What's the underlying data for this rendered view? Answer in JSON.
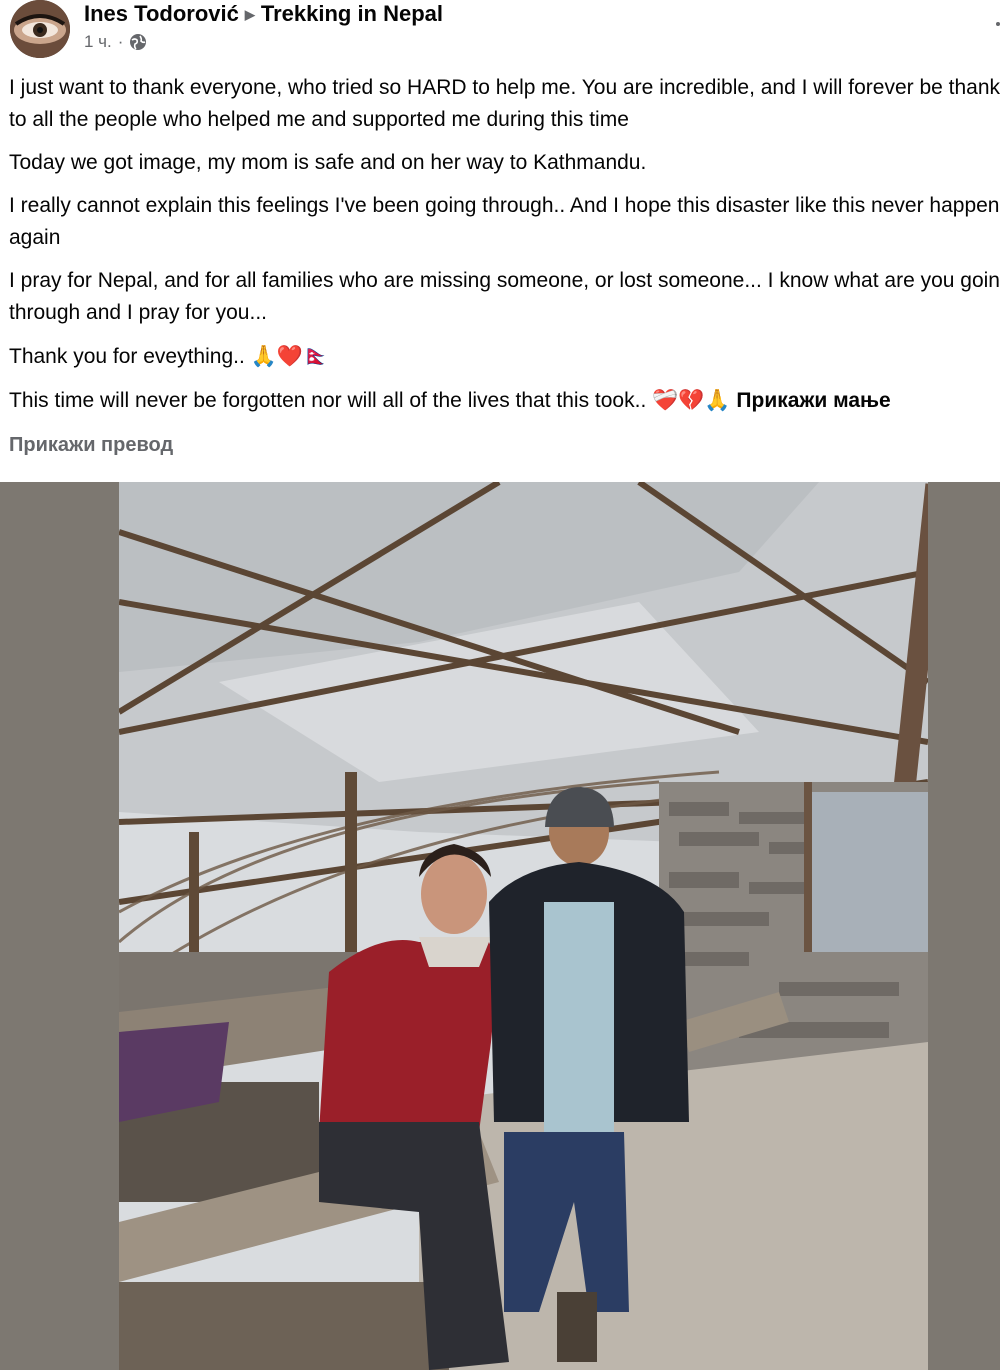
{
  "post": {
    "author": "Ines Todorović",
    "group": "Trekking in Nepal",
    "time": "1 ч.",
    "separator": "·",
    "paragraphs": [
      "I just want to thank everyone, who tried so HARD to help me. You are incredible, and I will forever be thankfull to all the people who helped me and supported me during this time",
      "Today we got image, my mom is safe and on her way to Kathmandu.",
      "I really cannot explain this feelings I've been going through.. And I hope this disaster like this never happens again",
      "I pray for Nepal, and for all families who are missing someone, or lost someone... I know what are you going through and I pray for you..."
    ],
    "thanks_line": "Thank you for eveything..",
    "thanks_emojis": "🙏❤️🇳🇵",
    "final_line": "This time will never be forgotten nor will all of the lives that this took..",
    "final_emojis": "❤️‍🩹💔🙏",
    "see_less": "Прикажи мање",
    "see_translation": "Прикажи превод"
  },
  "icons": {
    "privacy": "globe-icon",
    "group_arrow": "caret-right-icon"
  },
  "colors": {
    "text": "#050505",
    "secondary": "#65676b",
    "photo_background": "#7d7871"
  }
}
